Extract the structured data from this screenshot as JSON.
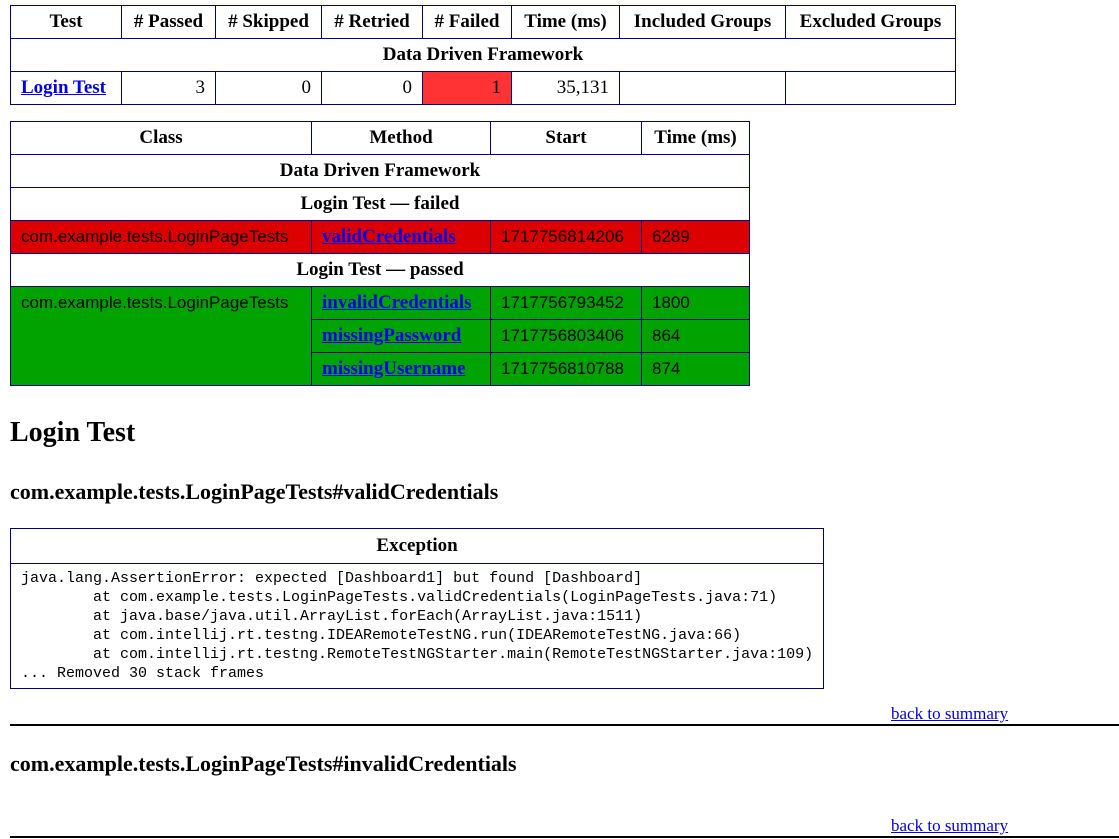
{
  "summary": {
    "headers": [
      "Test",
      "# Passed",
      "# Skipped",
      "# Retried",
      "# Failed",
      "Time (ms)",
      "Included Groups",
      "Excluded Groups"
    ],
    "suite_name": "Data Driven Framework",
    "row": {
      "test": "Login Test",
      "passed": "3",
      "skipped": "0",
      "retried": "0",
      "failed": "1",
      "time": "35,131",
      "included_groups": "",
      "excluded_groups": ""
    },
    "failed_color": "#ff3333"
  },
  "methods": {
    "headers": [
      "Class",
      "Method",
      "Start",
      "Time (ms)"
    ],
    "suite_name": "Data Driven Framework",
    "failed_section": "Login Test — failed",
    "passed_section": "Login Test — passed",
    "failed_rows": [
      {
        "class": "com.example.tests.LoginPageTests",
        "method": "validCredentials",
        "start": "1717756814206",
        "time": "6289"
      }
    ],
    "passed_class": "com.example.tests.LoginPageTests",
    "passed_rows": [
      {
        "method": "invalidCredentials",
        "start": "1717756793452",
        "time": "1800"
      },
      {
        "method": "missingPassword",
        "start": "1717756803406",
        "time": "864"
      },
      {
        "method": "missingUsername",
        "start": "1717756810788",
        "time": "874"
      }
    ],
    "failed_color": "#dd0000",
    "passed_color": "#00a300"
  },
  "details": {
    "test_title": "Login Test",
    "method1_title": "com.example.tests.LoginPageTests#validCredentials",
    "exception_header": "Exception",
    "exception_text": "java.lang.AssertionError: expected [Dashboard1] but found [Dashboard]\n\tat com.example.tests.LoginPageTests.validCredentials(LoginPageTests.java:71)\n\tat java.base/java.util.ArrayList.forEach(ArrayList.java:1511)\n\tat com.intellij.rt.testng.IDEARemoteTestNG.run(IDEARemoteTestNG.java:66)\n\tat com.intellij.rt.testng.RemoteTestNGStarter.main(RemoteTestNGStarter.java:109)\n... Removed 30 stack frames",
    "back_label": "back to summary",
    "method2_title": "com.example.tests.LoginPageTests#invalidCredentials"
  }
}
